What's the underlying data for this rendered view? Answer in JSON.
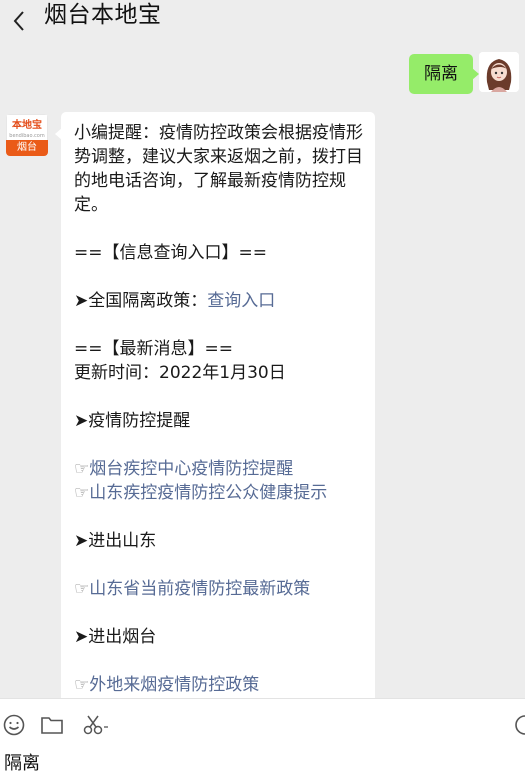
{
  "header": {
    "title": "烟台本地宝",
    "back_icon": "chevron-left-icon"
  },
  "me": {
    "message": "隔离"
  },
  "bot": {
    "avatar_brand": "本地宝",
    "avatar_sub": "bendibao.com",
    "avatar_city": "烟台",
    "reminder": "小编提醒：疫情防控政策会根据疫情形势调整，建议大家来返烟之前，拨打目的地电话咨询，了解最新疫情防控规定。",
    "info_header": "==【信息查询入口】==",
    "national_label": "➤全国隔离政策：",
    "national_link": "查询入口",
    "news_header": "==【最新消息】==",
    "update_time": "更新时间：2022年1月30日",
    "section1": "➤疫情防控提醒",
    "hand": "☞",
    "link1": "烟台疾控中心疫情防控提醒",
    "link2": "山东疾控疫情防控公众健康提示",
    "section2": "➤进出山东",
    "link3": "山东省当前疫情防控最新政策",
    "section3": "➤进出烟台",
    "link4": "外地来烟疫情防控政策"
  },
  "input": {
    "text": "隔离"
  },
  "colors": {
    "my_bubble": "#95ec69",
    "link": "#576b95",
    "brand_orange": "#ea5b18"
  }
}
